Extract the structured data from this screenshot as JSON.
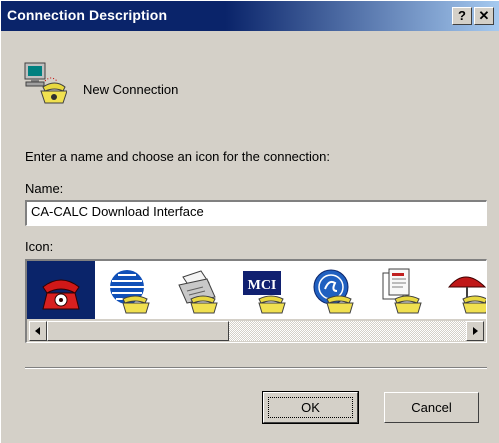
{
  "window": {
    "title": "Connection Description",
    "help_label": "?",
    "close_label": "✕"
  },
  "connection": {
    "icon": "phone-computer-icon",
    "name": "New Connection"
  },
  "instructions": "Enter a name and choose an icon for the connection:",
  "name_field": {
    "label": "Name:",
    "value": "CA-CALC Download Interface"
  },
  "icon_list": {
    "label": "Icon:",
    "items": [
      {
        "icon": "red-phone-icon",
        "selected": true
      },
      {
        "icon": "globe-phone-icon",
        "selected": false
      },
      {
        "icon": "fax-phone-icon",
        "selected": false
      },
      {
        "icon": "mci-phone-icon",
        "selected": false
      },
      {
        "icon": "ge-phone-icon",
        "selected": false
      },
      {
        "icon": "documents-phone-icon",
        "selected": false
      },
      {
        "icon": "umbrella-phone-icon",
        "selected": false
      }
    ],
    "scroll_position": 0
  },
  "buttons": {
    "ok": "OK",
    "cancel": "Cancel"
  },
  "colors": {
    "titlebar": "#0a246a",
    "face": "#d4d0c8",
    "selection": "#0a246a"
  }
}
